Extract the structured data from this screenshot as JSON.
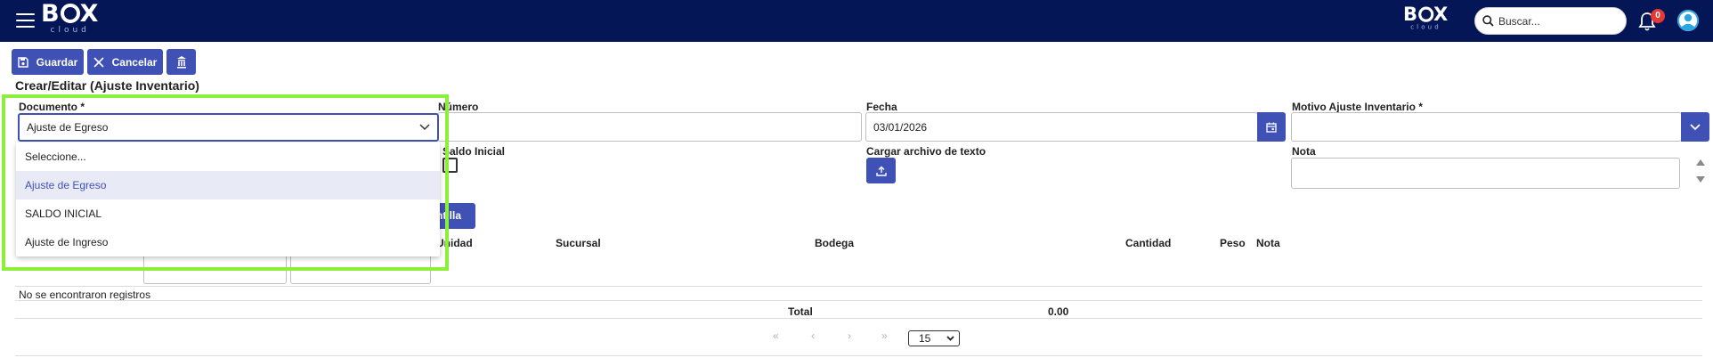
{
  "topbar": {
    "logo_main": "B",
    "logo_main_end": "X",
    "logo_sub": "cloud",
    "search_placeholder": "Buscar...",
    "notification_count": "0"
  },
  "toolbar": {
    "save_label": "Guardar",
    "cancel_label": "Cancelar"
  },
  "page_title": "Crear/Editar (Ajuste Inventario)",
  "form": {
    "documento_label": "Documento",
    "documento_value": "Ajuste de Egreso",
    "required_mark": "*",
    "numero_label": "Número",
    "fecha_label": "Fecha",
    "fecha_value": "03/01/2026",
    "motivo_label": "Motivo Ajuste Inventario",
    "saldo_inicial_label": "Saldo Inicial",
    "cargar_label": "Cargar archivo de texto",
    "nota_label": "Nota"
  },
  "dropdown": {
    "options": [
      "Seleccione...",
      "Ajuste de Egreso",
      "SALDO INICIAL",
      "Ajuste de Ingreso"
    ],
    "selected_index": 1
  },
  "plantilla_label": "ntilla",
  "table": {
    "headers": {
      "unidad": "Unidad",
      "sucursal": "Sucursal",
      "bodega": "Bodega",
      "cantidad": "Cantidad",
      "peso": "Peso",
      "nota": "Nota"
    },
    "empty_text": "No se encontraron registros",
    "total_label": "Total",
    "total_value": "0.00"
  },
  "pager": {
    "first": "«",
    "prev": "‹",
    "next": "›",
    "last": "»",
    "page_size": "15"
  },
  "colors": {
    "topbar": "#041656",
    "primary": "#3f51b5",
    "highlight": "#8cf03a",
    "badge": "#e53935"
  }
}
